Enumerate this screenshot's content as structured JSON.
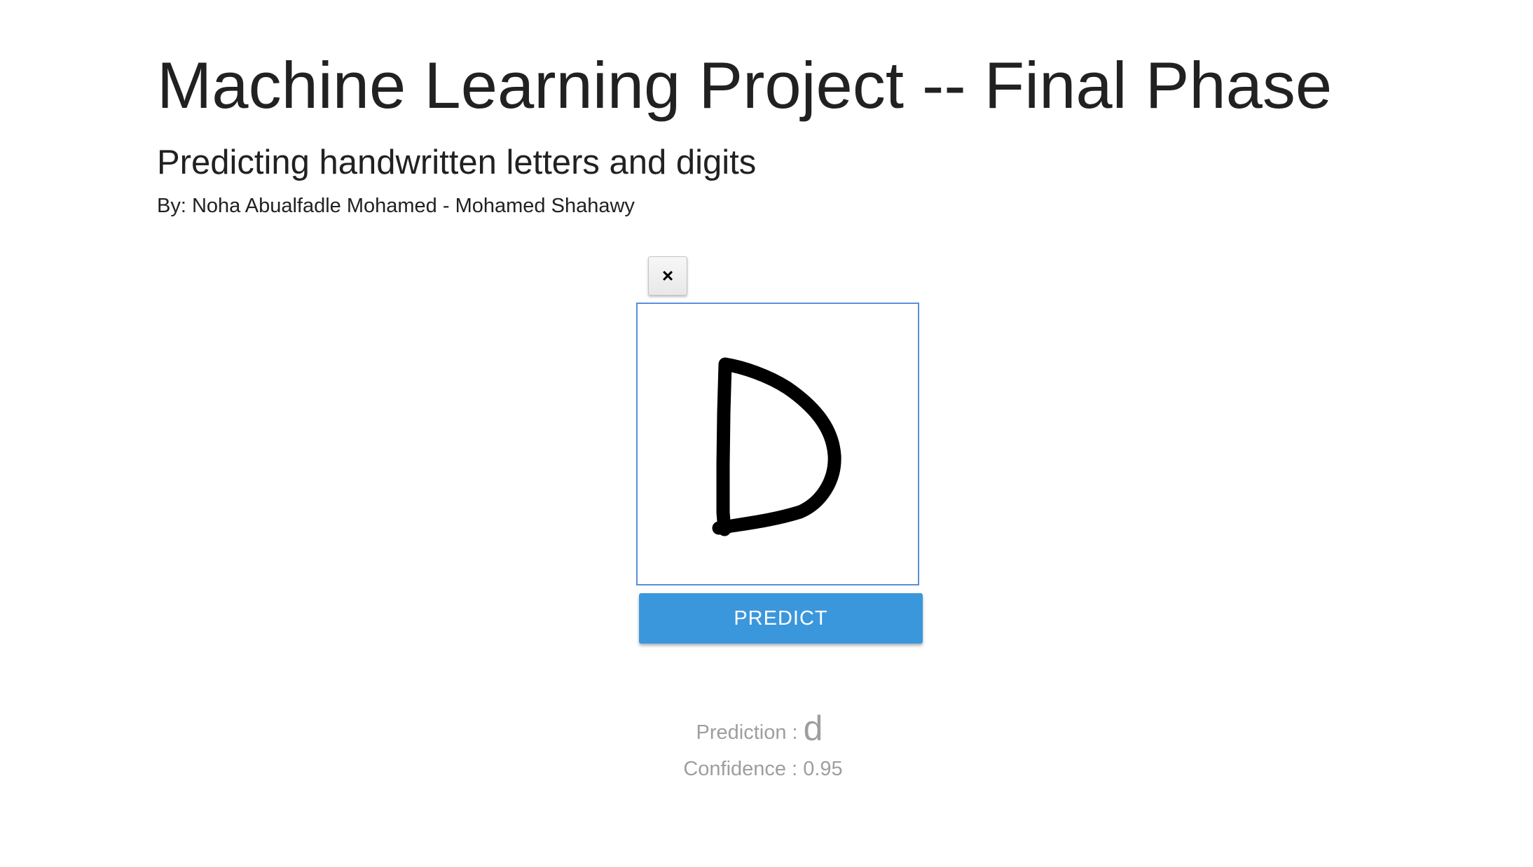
{
  "header": {
    "title": "Machine Learning Project -- Final Phase",
    "subtitle": "Predicting handwritten letters and digits",
    "authors": "By: Noha Abualfadle Mohamed - Mohamed Shahawy"
  },
  "canvas": {
    "clear_icon": "close-icon",
    "clear_label": "×",
    "stroke_color": "#000000",
    "border_color": "#5a8fd8"
  },
  "actions": {
    "predict_label": "PREDICT",
    "predict_color": "#3b97dc"
  },
  "result": {
    "prediction_label": "Prediction :",
    "prediction_value": "d",
    "confidence_label": "Confidence :",
    "confidence_value": "0.95"
  }
}
